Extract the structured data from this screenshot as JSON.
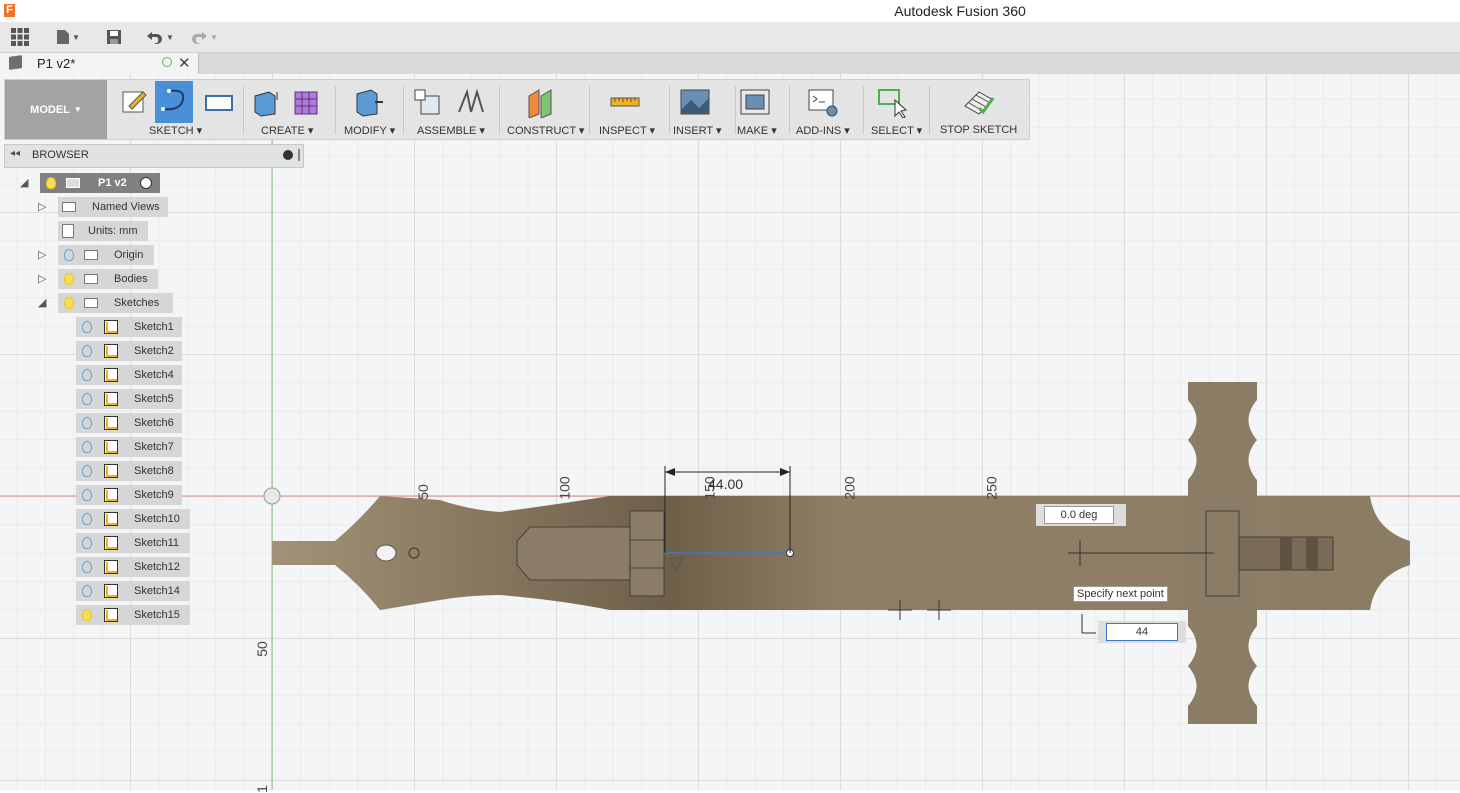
{
  "app": {
    "title": "Autodesk Fusion 360",
    "icon_letter": "F"
  },
  "document": {
    "tab_title": "P1 v2*"
  },
  "toolbar": {
    "workspace": "MODEL",
    "groups": [
      {
        "label": "SKETCH"
      },
      {
        "label": "CREATE"
      },
      {
        "label": "MODIFY"
      },
      {
        "label": "ASSEMBLE"
      },
      {
        "label": "CONSTRUCT"
      },
      {
        "label": "INSPECT"
      },
      {
        "label": "INSERT"
      },
      {
        "label": "MAKE"
      },
      {
        "label": "ADD-INS"
      },
      {
        "label": "SELECT"
      },
      {
        "label": "STOP SKETCH"
      }
    ]
  },
  "browser": {
    "title": "BROWSER",
    "root": "P1 v2",
    "items": [
      {
        "label": "Named Views"
      },
      {
        "label": "Units: mm"
      },
      {
        "label": "Origin"
      },
      {
        "label": "Bodies"
      },
      {
        "label": "Sketches"
      }
    ],
    "sketches": [
      "Sketch1",
      "Sketch2",
      "Sketch4",
      "Sketch5",
      "Sketch6",
      "Sketch7",
      "Sketch8",
      "Sketch9",
      "Sketch10",
      "Sketch11",
      "Sketch12",
      "Sketch14",
      "Sketch15"
    ]
  },
  "canvas": {
    "ruler_x": [
      "50",
      "100",
      "150",
      "200",
      "250"
    ],
    "ruler_y": [
      "50",
      "1"
    ],
    "dimension": "44.00",
    "angle_input": "0.0 deg",
    "tooltip": "Specify next point",
    "length_input": "44"
  },
  "colors": {
    "body_fill": "#8f7f66",
    "accent": "#3a7bc8",
    "axis_red": "#d9534f",
    "axis_green": "#4caf50"
  }
}
